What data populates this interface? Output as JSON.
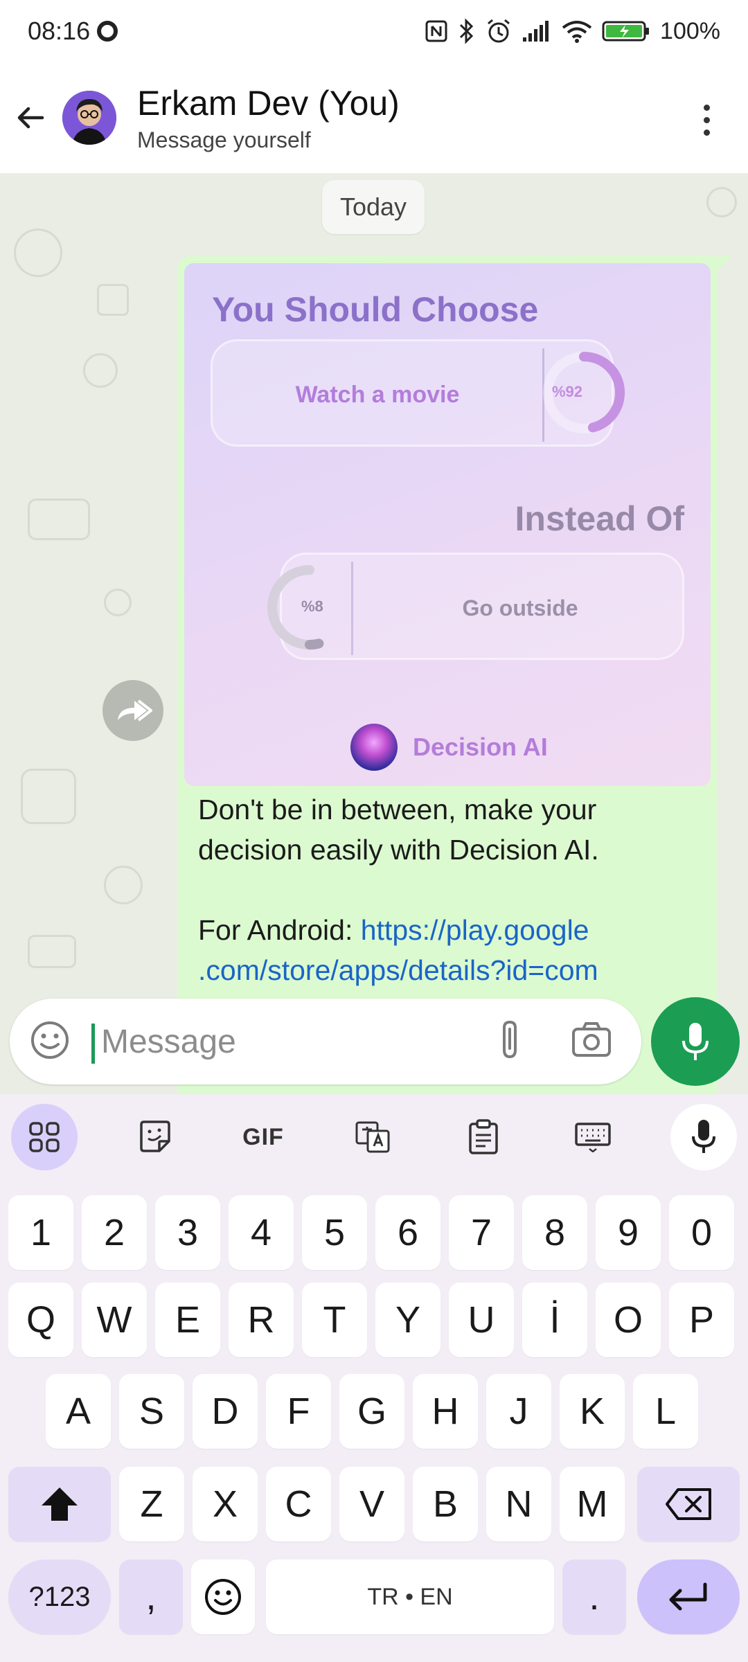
{
  "status_bar": {
    "time": "08:16",
    "battery": "100%"
  },
  "header": {
    "contact_name": "Erkam Dev (You)",
    "subtitle": "Message yourself"
  },
  "chat": {
    "date_chip": "Today",
    "message": {
      "image": {
        "title": "You Should Choose",
        "choice": "Watch a movie",
        "choice_percent": "%92",
        "choice_value": 92,
        "instead_label": "Instead Of",
        "alternative": "Go outside",
        "alternative_percent": "%8",
        "alternative_value": 8,
        "brand": "Decision AI"
      },
      "text_line1": "Don't be in between, make your",
      "text_line2": "decision easily with Decision AI.",
      "android_label": "For Android: ",
      "link_part1": "https://play.google",
      "link_part2": ".com/store/apps/details?id=com"
    }
  },
  "input": {
    "placeholder": "Message"
  },
  "keyboard": {
    "toolbar": {
      "gif_label": "GIF"
    },
    "row_numbers": [
      "1",
      "2",
      "3",
      "4",
      "5",
      "6",
      "7",
      "8",
      "9",
      "0"
    ],
    "row_top": [
      "Q",
      "W",
      "E",
      "R",
      "T",
      "Y",
      "U",
      "İ",
      "O",
      "P"
    ],
    "row_middle": [
      "A",
      "S",
      "D",
      "F",
      "G",
      "H",
      "J",
      "K",
      "L"
    ],
    "row_bottom": [
      "Z",
      "X",
      "C",
      "V",
      "B",
      "N",
      "M"
    ],
    "symbols_key": "?123",
    "comma_key": ",",
    "space_label": "TR • EN",
    "period_key": "."
  },
  "colors": {
    "accent_green": "#1b9d54",
    "bubble_green": "#dcfad0",
    "link_blue": "#1a64c8",
    "brand_purple": "#b47dd9"
  }
}
